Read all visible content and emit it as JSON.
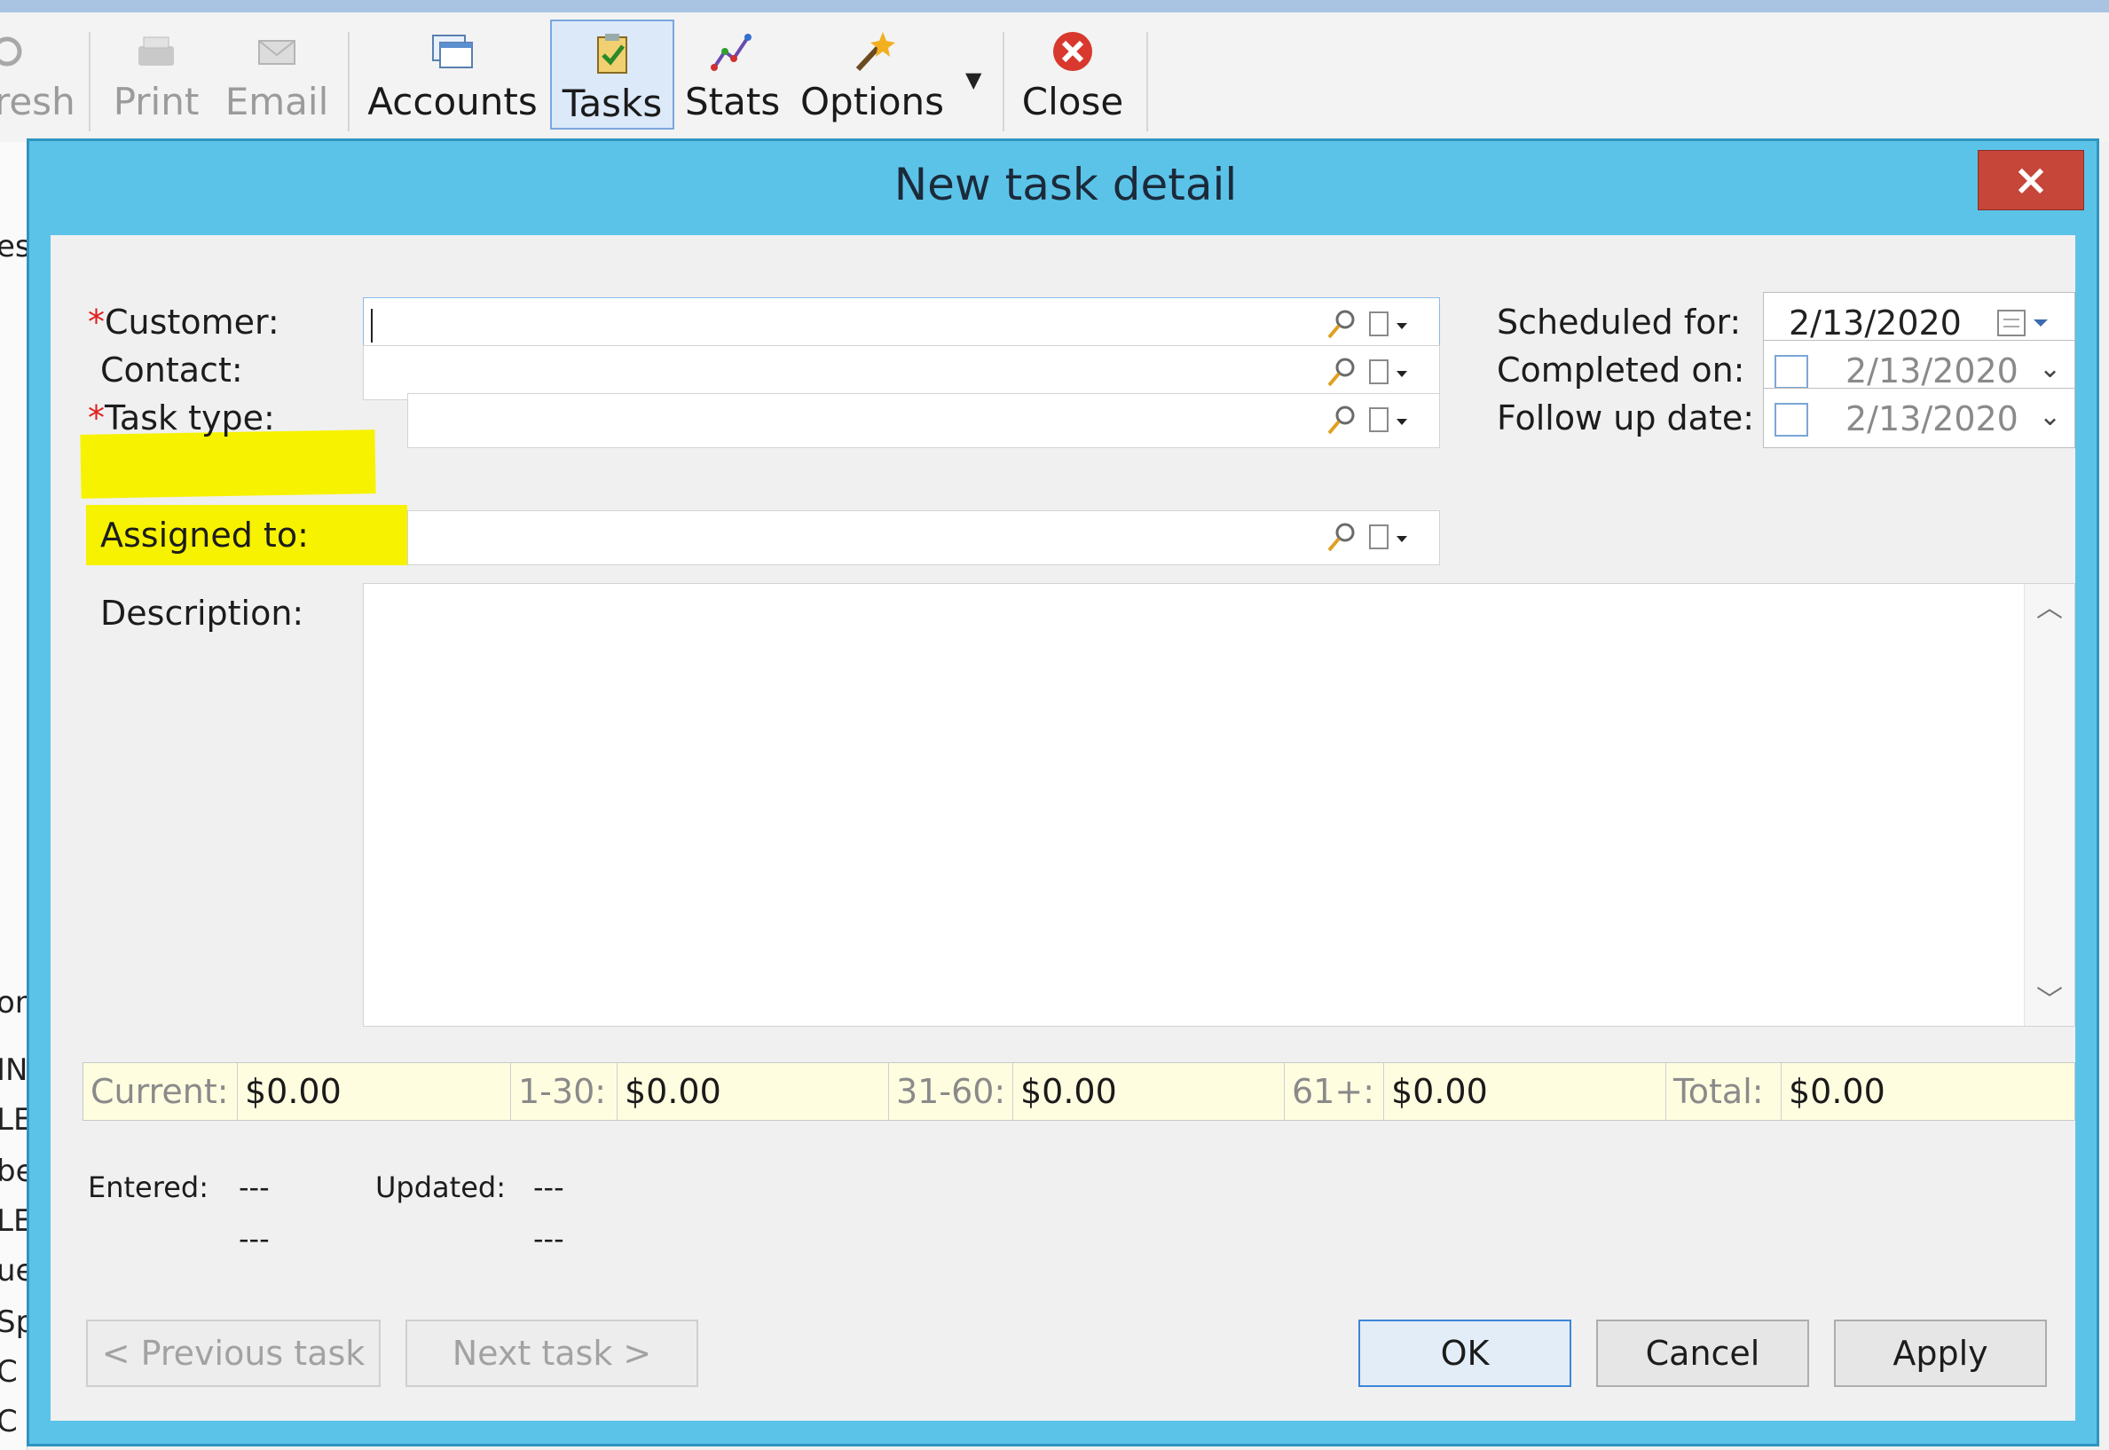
{
  "toolbar": {
    "refresh_label": "resh",
    "print_label": "Print",
    "email_label": "Email",
    "accounts_label": "Accounts",
    "tasks_label": "Tasks",
    "stats_label": "Stats",
    "options_label": "Options",
    "close_label": "Close"
  },
  "background_fragments": [
    "es",
    "on",
    "IN",
    "LE",
    "be",
    "LE",
    "ue",
    "Sp",
    "C",
    "C"
  ],
  "dialog": {
    "title": "New task detail",
    "close_glyph": "×"
  },
  "form": {
    "required_mark": "*",
    "customer_label": "Customer:",
    "contact_label": "Contact:",
    "task_type_label": "Task type:",
    "assigned_to_label": "Assigned to:",
    "description_label": "Description:",
    "scheduled_for_label": "Scheduled for:",
    "scheduled_for_value": "2/13/2020",
    "completed_on_label": "Completed on:",
    "completed_on_value": "2/13/2020",
    "follow_up_label": "Follow up date:",
    "follow_up_value": "2/13/2020"
  },
  "aging": {
    "current_label": "Current:",
    "current_value": "$0.00",
    "d1_30_label": "1-30:",
    "d1_30_value": "$0.00",
    "d31_60_label": "31-60:",
    "d31_60_value": "$0.00",
    "d61_label": "61+:",
    "d61_value": "$0.00",
    "total_label": "Total:",
    "total_value": "$0.00"
  },
  "meta": {
    "entered_label": "Entered:",
    "entered_value": "---",
    "entered_value2": "---",
    "updated_label": "Updated:",
    "updated_value": "---",
    "updated_value2": "---"
  },
  "buttons": {
    "previous": "< Previous task",
    "next": "Next task >",
    "ok": "OK",
    "cancel": "Cancel",
    "apply": "Apply"
  },
  "colors": {
    "dialog_frame": "#5cc3e8",
    "highlight": "#f6f200",
    "close_red": "#c6463a",
    "aging_bg": "#fffde0"
  }
}
